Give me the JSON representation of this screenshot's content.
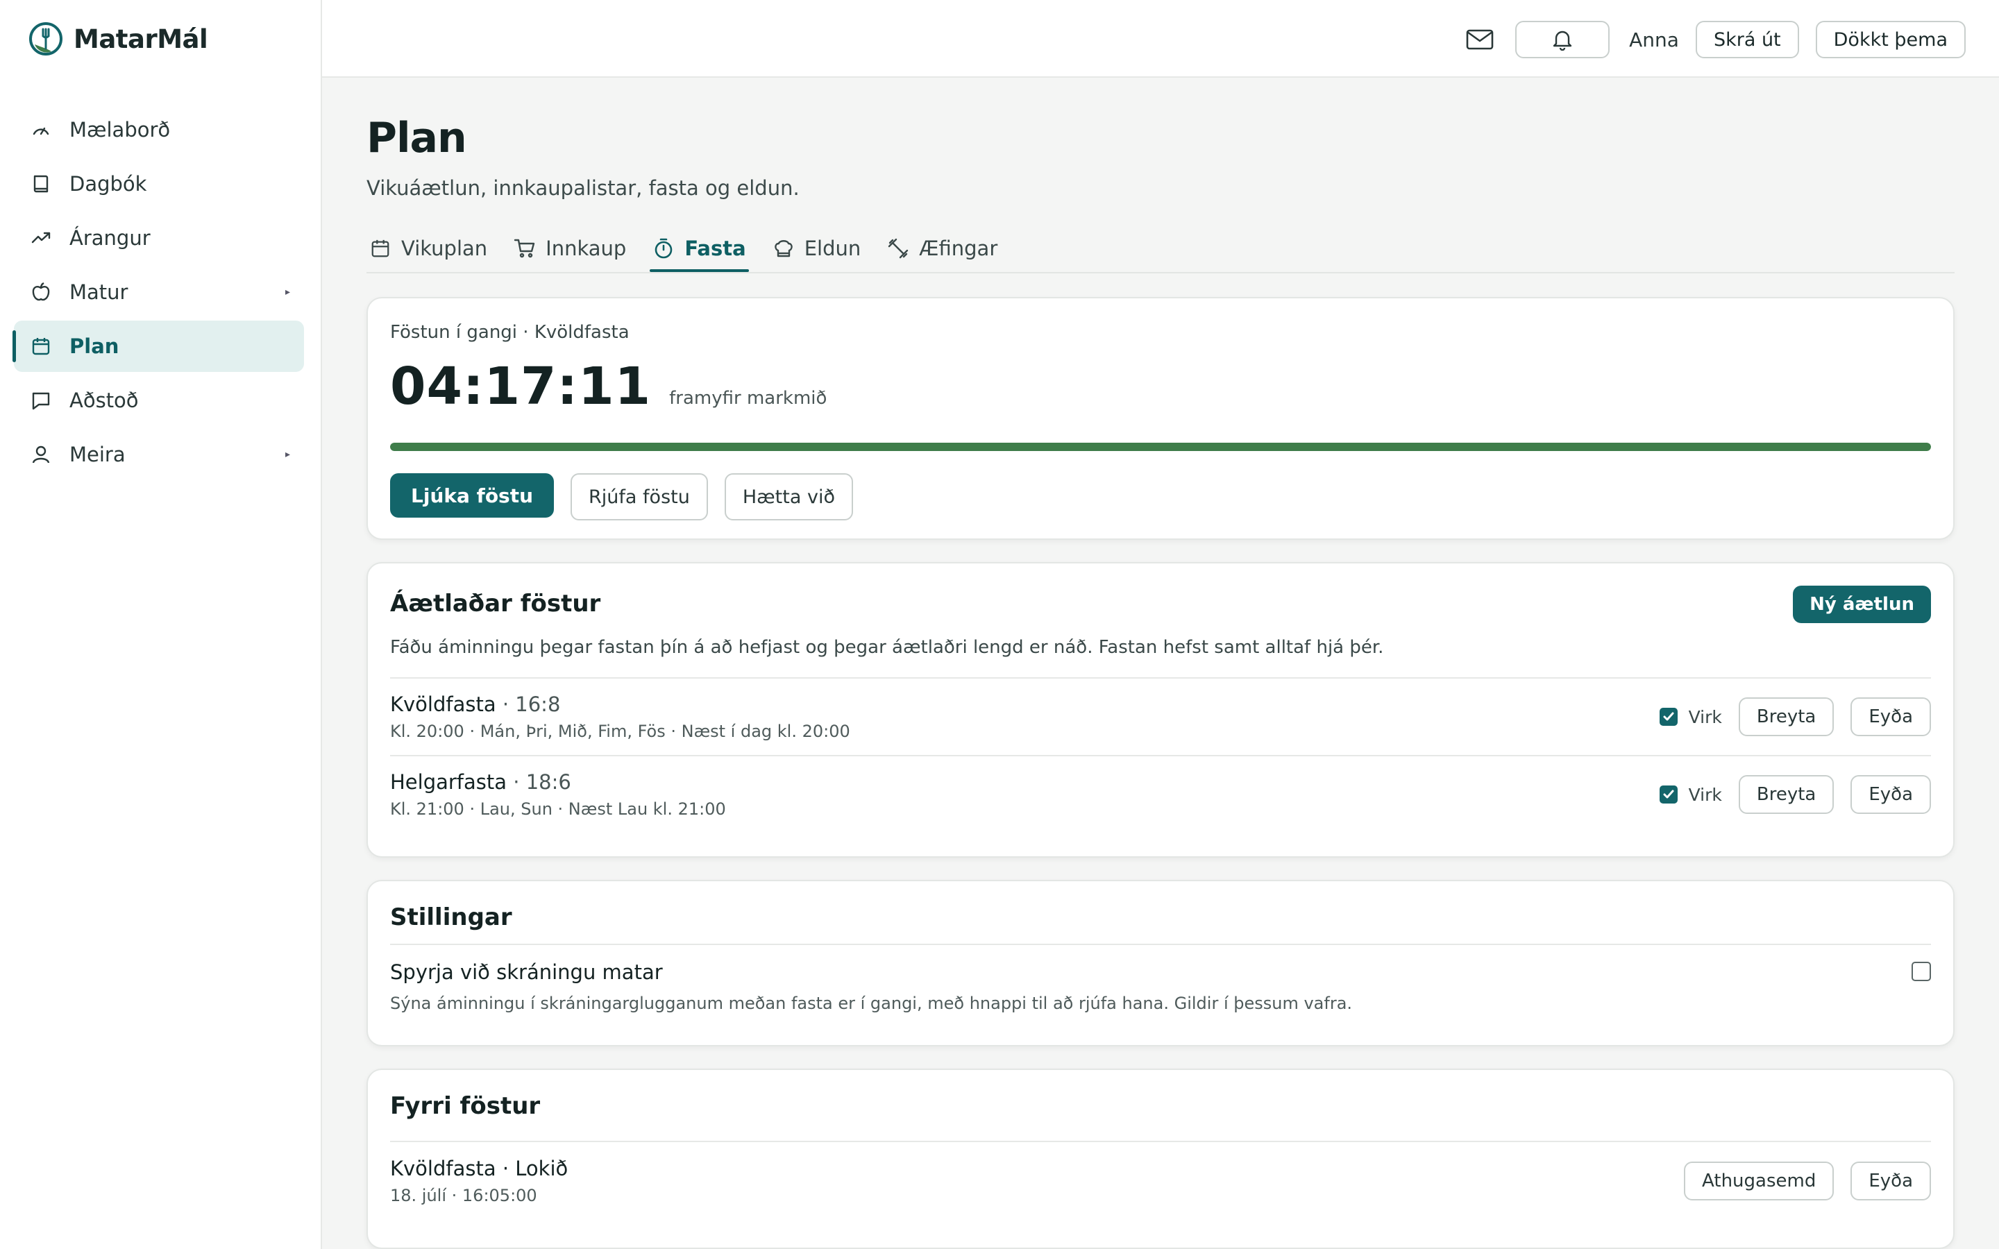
{
  "app": {
    "name": "MatarMál",
    "brand_color": "#13656a",
    "accent_color": "#3f7d4a"
  },
  "sidebar": {
    "items": [
      {
        "label": "Mælaborð",
        "icon": "gauge-icon"
      },
      {
        "label": "Dagbók",
        "icon": "book-icon"
      },
      {
        "label": "Árangur",
        "icon": "trending-up-icon"
      },
      {
        "label": "Matur",
        "icon": "apple-icon",
        "has_submenu": true
      },
      {
        "label": "Plan",
        "icon": "calendar-icon",
        "active": true
      },
      {
        "label": "Aðstoð",
        "icon": "chat-icon"
      },
      {
        "label": "Meira",
        "icon": "user-icon",
        "has_submenu": true
      }
    ]
  },
  "topbar": {
    "user": "Anna",
    "logout_label": "Skrá út",
    "theme_label": "Dökkt þema"
  },
  "page": {
    "title": "Plan",
    "subtitle": "Vikuáætlun, innkaupalistar, fasta og eldun."
  },
  "tabs": [
    {
      "label": "Vikuplan",
      "icon": "calendar-icon"
    },
    {
      "label": "Innkaup",
      "icon": "cart-icon"
    },
    {
      "label": "Fasta",
      "icon": "timer-icon",
      "active": true
    },
    {
      "label": "Eldun",
      "icon": "chef-hat-icon"
    },
    {
      "label": "Æfingar",
      "icon": "dumbbell-icon"
    }
  ],
  "active_fast": {
    "label": "Föstun í gangi · Kvöldfasta",
    "timer": "04:17:11",
    "timer_note": "framyfir markmið",
    "progress_fraction": 1.0,
    "finish_label": "Ljúka föstu",
    "break_label": "Rjúfa föstu",
    "cancel_label": "Hætta við"
  },
  "scheduled": {
    "title": "Áætlaðar föstur",
    "new_label": "Ný áætlun",
    "description": "Fáðu áminningu þegar fastan þín á að hefjast og þegar áætlaðri lengd er náð. Fastan hefst samt alltaf hjá þér.",
    "items": [
      {
        "name": "Kvöldfasta",
        "ratio": " · 16:8",
        "details": "Kl. 20:00 · Mán, Þri, Mið, Fim, Fös · Næst í dag kl. 20:00",
        "active": true,
        "active_label": "Virk",
        "edit_label": "Breyta",
        "delete_label": "Eyða"
      },
      {
        "name": "Helgarfasta",
        "ratio": " · 18:6",
        "details": "Kl. 21:00 · Lau, Sun · Næst Lau kl. 21:00",
        "active": true,
        "active_label": "Virk",
        "edit_label": "Breyta",
        "delete_label": "Eyða"
      }
    ]
  },
  "settings": {
    "title": "Stillingar",
    "option_title": "Spyrja við skráningu matar",
    "option_desc": "Sýna áminningu í skráningarglugganum meðan fasta er í gangi, með hnappi til að rjúfa hana. Gildir í þessum vafra.",
    "option_checked": false
  },
  "history": {
    "title": "Fyrri föstur",
    "items": [
      {
        "title": "Kvöldfasta · Lokið",
        "date": "18. júlí · 16:05:00",
        "note_label": "Athugasemd",
        "delete_label": "Eyða"
      }
    ]
  }
}
